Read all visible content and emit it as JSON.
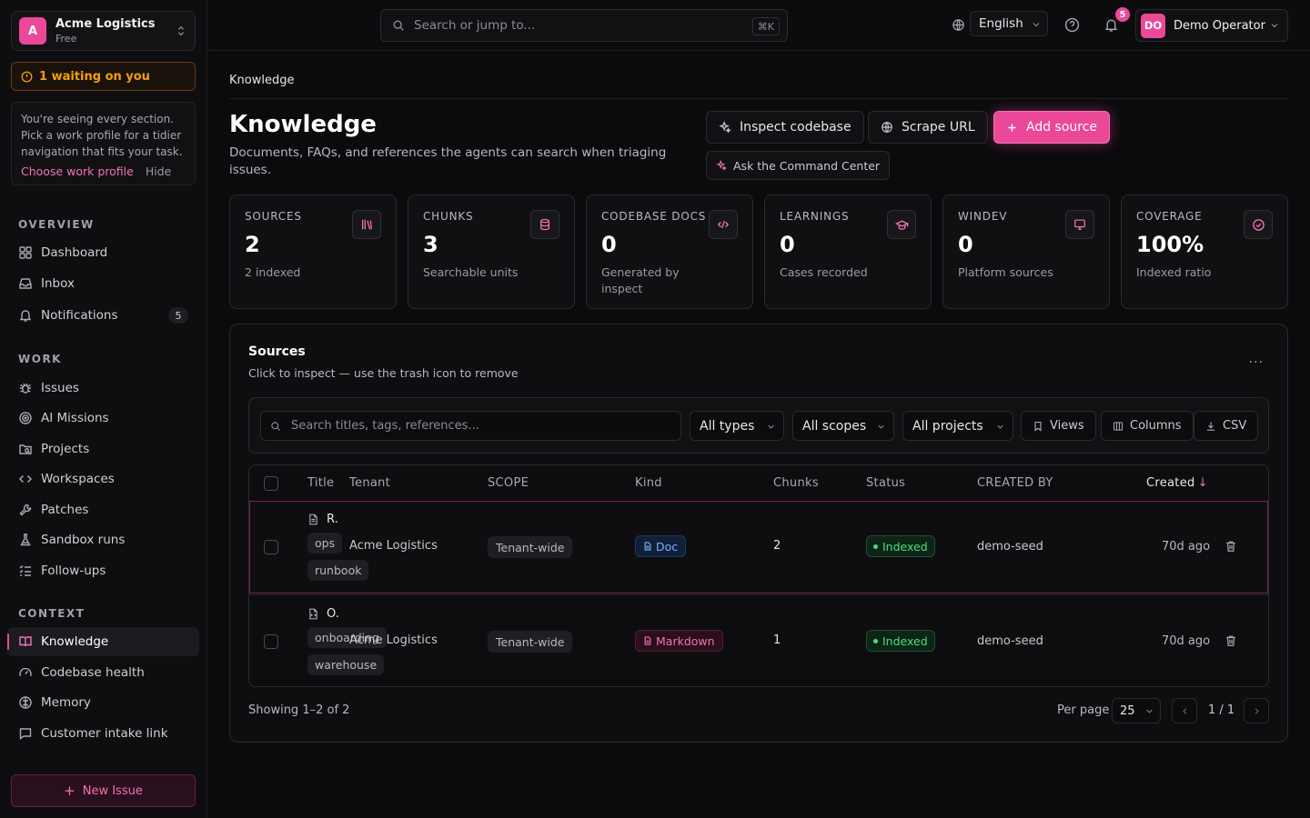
{
  "org": {
    "initial": "A",
    "name": "Acme Logistics",
    "plan": "Free"
  },
  "waiting": {
    "label": "1 waiting on you"
  },
  "profile_hint": {
    "text": "You're seeing every section. Pick a work profile for a tidier navigation that fits your task.",
    "action": "Choose work profile",
    "hide": "Hide"
  },
  "sidebar": {
    "overview_label": "OVERVIEW",
    "overview": [
      {
        "label": "Dashboard"
      },
      {
        "label": "Inbox"
      },
      {
        "label": "Notifications",
        "badge": "5"
      }
    ],
    "work_label": "WORK",
    "work": [
      {
        "label": "Issues"
      },
      {
        "label": "AI Missions"
      },
      {
        "label": "Projects"
      },
      {
        "label": "Workspaces"
      },
      {
        "label": "Patches"
      },
      {
        "label": "Sandbox runs"
      },
      {
        "label": "Follow-ups"
      }
    ],
    "context_label": "CONTEXT",
    "context": [
      {
        "label": "Knowledge",
        "active": true
      },
      {
        "label": "Codebase health"
      },
      {
        "label": "Memory"
      },
      {
        "label": "Customer intake link"
      }
    ],
    "new_issue": "New Issue"
  },
  "topbar": {
    "search_placeholder": "Search or jump to...",
    "search_shortcut": "⌘K",
    "language": "English",
    "notification_count": "5",
    "user_initials": "DO",
    "user_name": "Demo Operator"
  },
  "page": {
    "breadcrumb": "Knowledge",
    "title": "Knowledge",
    "description": "Documents, FAQs, and references the agents can search when triaging issues.",
    "actions": {
      "inspect": "Inspect codebase",
      "scrape": "Scrape URL",
      "add": "Add source",
      "ask": "Ask the Command Center"
    }
  },
  "stats": [
    {
      "label": "SOURCES",
      "value": "2",
      "sub": "2 indexed",
      "icon": "library-icon"
    },
    {
      "label": "CHUNKS",
      "value": "3",
      "sub": "Searchable units",
      "icon": "database-icon"
    },
    {
      "label": "CODEBASE DOCS",
      "value": "0",
      "sub": "Generated by inspect",
      "icon": "code-icon"
    },
    {
      "label": "LEARNINGS",
      "value": "0",
      "sub": "Cases recorded",
      "icon": "graduation-cap-icon"
    },
    {
      "label": "WINDEV",
      "value": "0",
      "sub": "Platform sources",
      "icon": "monitor-icon"
    },
    {
      "label": "COVERAGE",
      "value": "100%",
      "sub": "Indexed ratio",
      "icon": "check-circle-icon"
    }
  ],
  "sources": {
    "title": "Sources",
    "subtitle": "Click to inspect — use the trash icon to remove",
    "more": "···",
    "filters": {
      "search_placeholder": "Search titles, tags, references...",
      "types": "All types",
      "scopes": "All scopes",
      "projects": "All projects",
      "views": "Views",
      "columns": "Columns",
      "csv": "CSV"
    },
    "columns": [
      "Title",
      "Tenant",
      "SCOPE",
      "Kind",
      "Chunks",
      "Status",
      "CREATED BY",
      "Created"
    ],
    "sort_arrow": "↓",
    "rows": [
      {
        "title": "R.",
        "tags": [
          "ops",
          "runbook"
        ],
        "tenant": "Acme Logistics",
        "scope": "Tenant-wide",
        "kind": "Doc",
        "chunks": "2",
        "status": "Indexed",
        "created_by": "demo-seed",
        "created": "70d ago"
      },
      {
        "title": "O.",
        "tags": [
          "onboarding",
          "warehouse"
        ],
        "tenant": "Acme Logistics",
        "scope": "Tenant-wide",
        "kind": "Markdown",
        "chunks": "1",
        "status": "Indexed",
        "created_by": "demo-seed",
        "created": "70d ago"
      }
    ],
    "showing": "Showing 1–2 of 2",
    "per_page_label": "Per page",
    "per_page": "25",
    "page_info": "1 / 1"
  },
  "colors": {
    "accent": "#ec4899",
    "success": "#4ade80",
    "warning": "#f59e0b",
    "info": "#7fb0ff"
  }
}
